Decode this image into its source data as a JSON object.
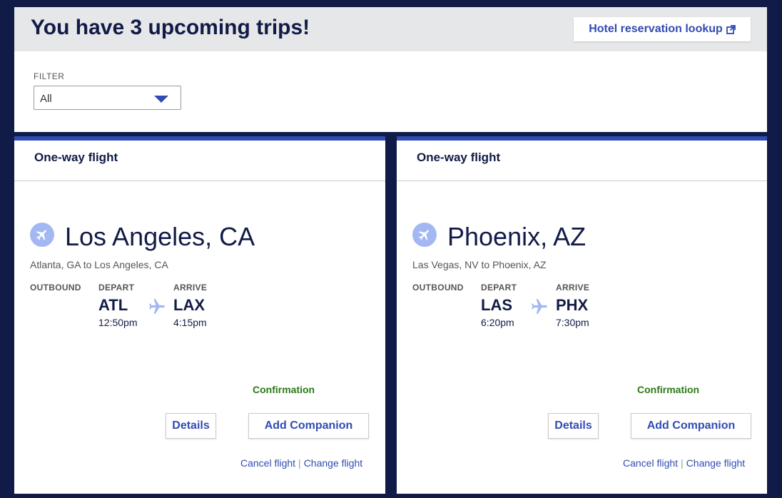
{
  "header": {
    "title": "You have 3 upcoming trips!",
    "hotel_lookup_label": "Hotel reservation lookup",
    "hotel_lookup_icon": "external-link-icon"
  },
  "filter": {
    "label": "FILTER",
    "selected": "All"
  },
  "colors": {
    "background": "#111b47",
    "accent": "#304cb2",
    "confirmation": "#2b7a16",
    "icon_circle": "#a3b7f3"
  },
  "trips": [
    {
      "type": "One-way flight",
      "destination": "Los Angeles, CA",
      "route": "Atlanta, GA to Los Angeles, CA",
      "direction_label": "OUTBOUND",
      "depart_label": "DEPART",
      "arrive_label": "ARRIVE",
      "depart_code": "ATL",
      "depart_time": "12:50pm",
      "arrive_code": "LAX",
      "arrive_time": "4:15pm",
      "confirmation": "Confirmation",
      "details_label": "Details",
      "companion_label": "Add Companion",
      "cancel_label": "Cancel flight",
      "change_label": "Change flight",
      "separator": "|"
    },
    {
      "type": "One-way flight",
      "destination": "Phoenix, AZ",
      "route": "Las Vegas, NV to Phoenix, AZ",
      "direction_label": "OUTBOUND",
      "depart_label": "DEPART",
      "arrive_label": "ARRIVE",
      "depart_code": "LAS",
      "depart_time": "6:20pm",
      "arrive_code": "PHX",
      "arrive_time": "7:30pm",
      "confirmation": "Confirmation",
      "details_label": "Details",
      "companion_label": "Add Companion",
      "cancel_label": "Cancel flight",
      "change_label": "Change flight",
      "separator": "|"
    }
  ]
}
